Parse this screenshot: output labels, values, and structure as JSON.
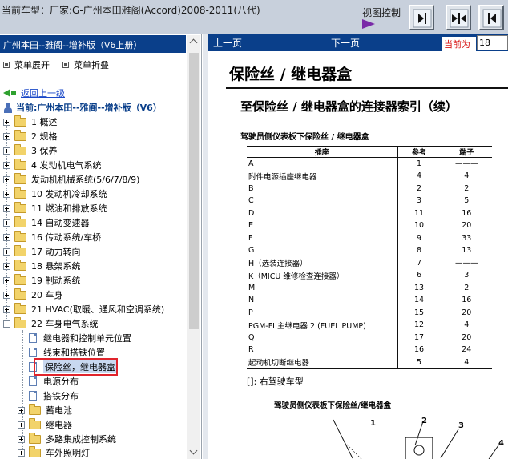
{
  "window": {
    "title": "当前车型：厂家:G-广州本田雅阁(Accord)2008-2011(八代)",
    "view_control_label": "视图控制",
    "view_buttons": [
      "next-page-icon",
      "fit-icon",
      "prev-page-icon"
    ]
  },
  "left_panel": {
    "header": "广州本田--雅阁--增补版（V6上册）",
    "expand_all": "菜单展开",
    "collapse_all": "菜单折叠",
    "back_link": "返回上一级",
    "current_label": "当前:广州本田--雅阁--增补版（V6）",
    "tree": [
      {
        "label": "1 概述"
      },
      {
        "label": "2 规格"
      },
      {
        "label": "3 保养"
      },
      {
        "label": "4 发动机电气系统"
      },
      {
        "label": "发动机机械系统(5/6/7/8/9)"
      },
      {
        "label": "10 发动机冷却系统"
      },
      {
        "label": "11 燃油和排放系统"
      },
      {
        "label": "14 自动变速器"
      },
      {
        "label": "16 传动系统/车桥"
      },
      {
        "label": "17 动力转向"
      },
      {
        "label": "18 悬架系统"
      },
      {
        "label": "19 制动系统"
      },
      {
        "label": "20 车身"
      },
      {
        "label": "21 HVAC(取暖、通风和空调系统)"
      },
      {
        "label": "22 车身电气系统"
      }
    ],
    "subtree": [
      {
        "label": "继电器和控制单元位置"
      },
      {
        "label": "线束和搭铁位置"
      },
      {
        "label": "保险丝，继电器盒"
      },
      {
        "label": "电源分布"
      },
      {
        "label": "搭铁分布"
      }
    ],
    "subfolders": [
      {
        "label": "蓄电池"
      },
      {
        "label": "继电器"
      },
      {
        "label": "多路集成控制系统"
      },
      {
        "label": "车外照明灯"
      }
    ]
  },
  "navbar": {
    "prev": "上一页",
    "next": "下一页",
    "current_label": "当前为",
    "page_value": "18"
  },
  "document": {
    "title": "保险丝 / 继电器盒",
    "subtitle": "至保险丝 / 继电器盒的连接器索引（续）",
    "caption": "驾驶员侧仪表板下保险丝 / 继电器盒",
    "columns": [
      "插座",
      "参考",
      "端子"
    ],
    "rows": [
      [
        "A",
        "1",
        "———"
      ],
      [
        "附件电源插座继电器",
        "4",
        "4"
      ],
      [
        "B",
        "2",
        "2"
      ],
      [
        "C",
        "3",
        "5"
      ],
      [
        "D",
        "11",
        "16"
      ],
      [
        "E",
        "10",
        "20"
      ],
      [
        "F",
        "9",
        "33"
      ],
      [
        "G",
        "8",
        "13"
      ],
      [
        "H（选装连接器）",
        "7",
        "———"
      ],
      [
        "K（MICU 维修检查连接器）",
        "6",
        "3"
      ],
      [
        "M",
        "13",
        "2"
      ],
      [
        "N",
        "14",
        "16"
      ],
      [
        "P",
        "15",
        "20"
      ],
      [
        "PGM-FI 主继电器 2 (FUEL PUMP)",
        "12",
        "4"
      ],
      [
        "Q",
        "17",
        "20"
      ],
      [
        "R",
        "16",
        "24"
      ],
      [
        "起动机切断继电器",
        "5",
        "4"
      ]
    ],
    "note": "[]: 右驾驶车型",
    "diagram_title": "驾驶员侧仪表板下保险丝/继电器盒",
    "diagram_numbers": [
      "1",
      "2",
      "3",
      "4"
    ]
  },
  "colors": {
    "header_blue": "#0a3f8a",
    "highlight_red": "#e0242c",
    "link_blue": "#1a48c8"
  }
}
